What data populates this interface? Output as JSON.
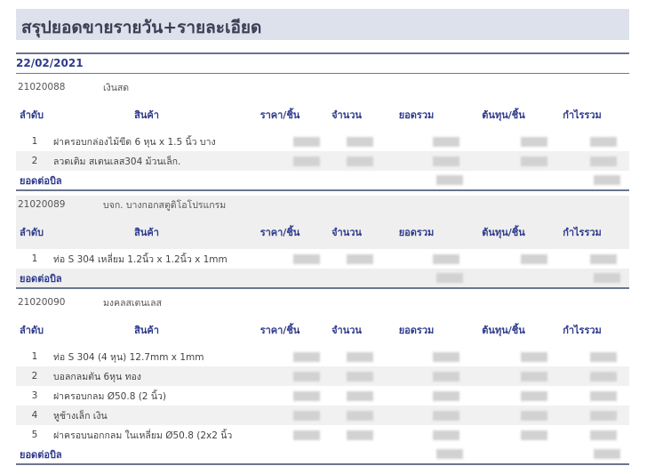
{
  "title": "สรุปยอดขายรายวัน+รายละเอียด",
  "date": "22/02/2021",
  "columns": [
    "ลำดับ",
    "สินค้า",
    "ราคา/ชิ้น",
    "จำนวน",
    "ยอดรวม",
    "ต้นทุน/ชิ้น",
    "กำไรรวม"
  ],
  "total_label": "ยอดต่อบิล",
  "bills": [
    {
      "no": "21020088",
      "customer": "เงินสด",
      "items": [
        {
          "seq": "1",
          "product": "ฝาครอบกล่องไม้ขีด  6 หุน x 1.5 นิ้ว บาง"
        },
        {
          "seq": "2",
          "product": "ลวดเติม สเตนเลส304  ม้วนเล็ก."
        }
      ]
    },
    {
      "no": "21020089",
      "customer": "บจก. บางกอกสตูดิโอโปรแกรม",
      "items": [
        {
          "seq": "1",
          "product": "ท่อ S 304 เหลี่ยม 1.2นิ้ว x 1.2นิ้ว x 1mm"
        }
      ]
    },
    {
      "no": "21020090",
      "customer": "มงคลสเตนเลส",
      "items": [
        {
          "seq": "1",
          "product": "ท่อ S 304 (4 หุน) 12.7mm x 1mm"
        },
        {
          "seq": "2",
          "product": "บอลกลมตัน 6หุน ทอง"
        },
        {
          "seq": "3",
          "product": "ฝาครอบกลม Ø50.8 (2 นิ้ว)"
        },
        {
          "seq": "4",
          "product": "หูช้างเล็ก  เงิน"
        },
        {
          "seq": "5",
          "product": "ฝาครอบนอกกลม ในเหลี่ยม  Ø50.8 (2x2 นิ้ว"
        }
      ]
    }
  ]
}
